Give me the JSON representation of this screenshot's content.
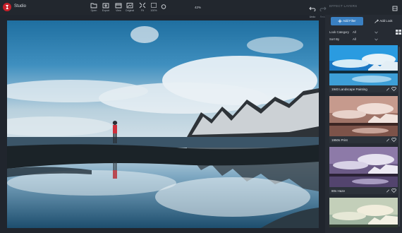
{
  "app": {
    "title": "Studio",
    "zoom": "42%"
  },
  "toolbar": {
    "open": "Open",
    "export": "Export",
    "view": "View",
    "original": "Original",
    "fit": "Fit",
    "hundred": "100%",
    "undo": "Undo",
    "redo": "Redo",
    "tools": "Tools Lists"
  },
  "panel": {
    "title": "EFFECT LAYERS",
    "tab_filter": "Add Filter",
    "tab_look": "Add Look",
    "look_category_label": "Look Category",
    "look_category_value": "All",
    "sort_by_label": "Sort By",
    "sort_by_value": "All"
  },
  "looks": [
    {
      "label": "1940 Landscape Painting"
    },
    {
      "label": "1950s Print"
    },
    {
      "label": "80s Haze"
    }
  ],
  "colors": {
    "accent": "#3a80c2",
    "brand": "#c8202a",
    "background": "#20252d"
  },
  "icons": [
    "logo-icon",
    "open-icon",
    "export-icon",
    "view-icon",
    "original-icon",
    "fit-icon",
    "hundred-icon",
    "compare-icon",
    "undo-icon",
    "redo-icon",
    "tools-icon",
    "plus-icon",
    "wand-icon",
    "grid-icon",
    "chevron-down-icon",
    "pen-icon",
    "heart-icon"
  ]
}
